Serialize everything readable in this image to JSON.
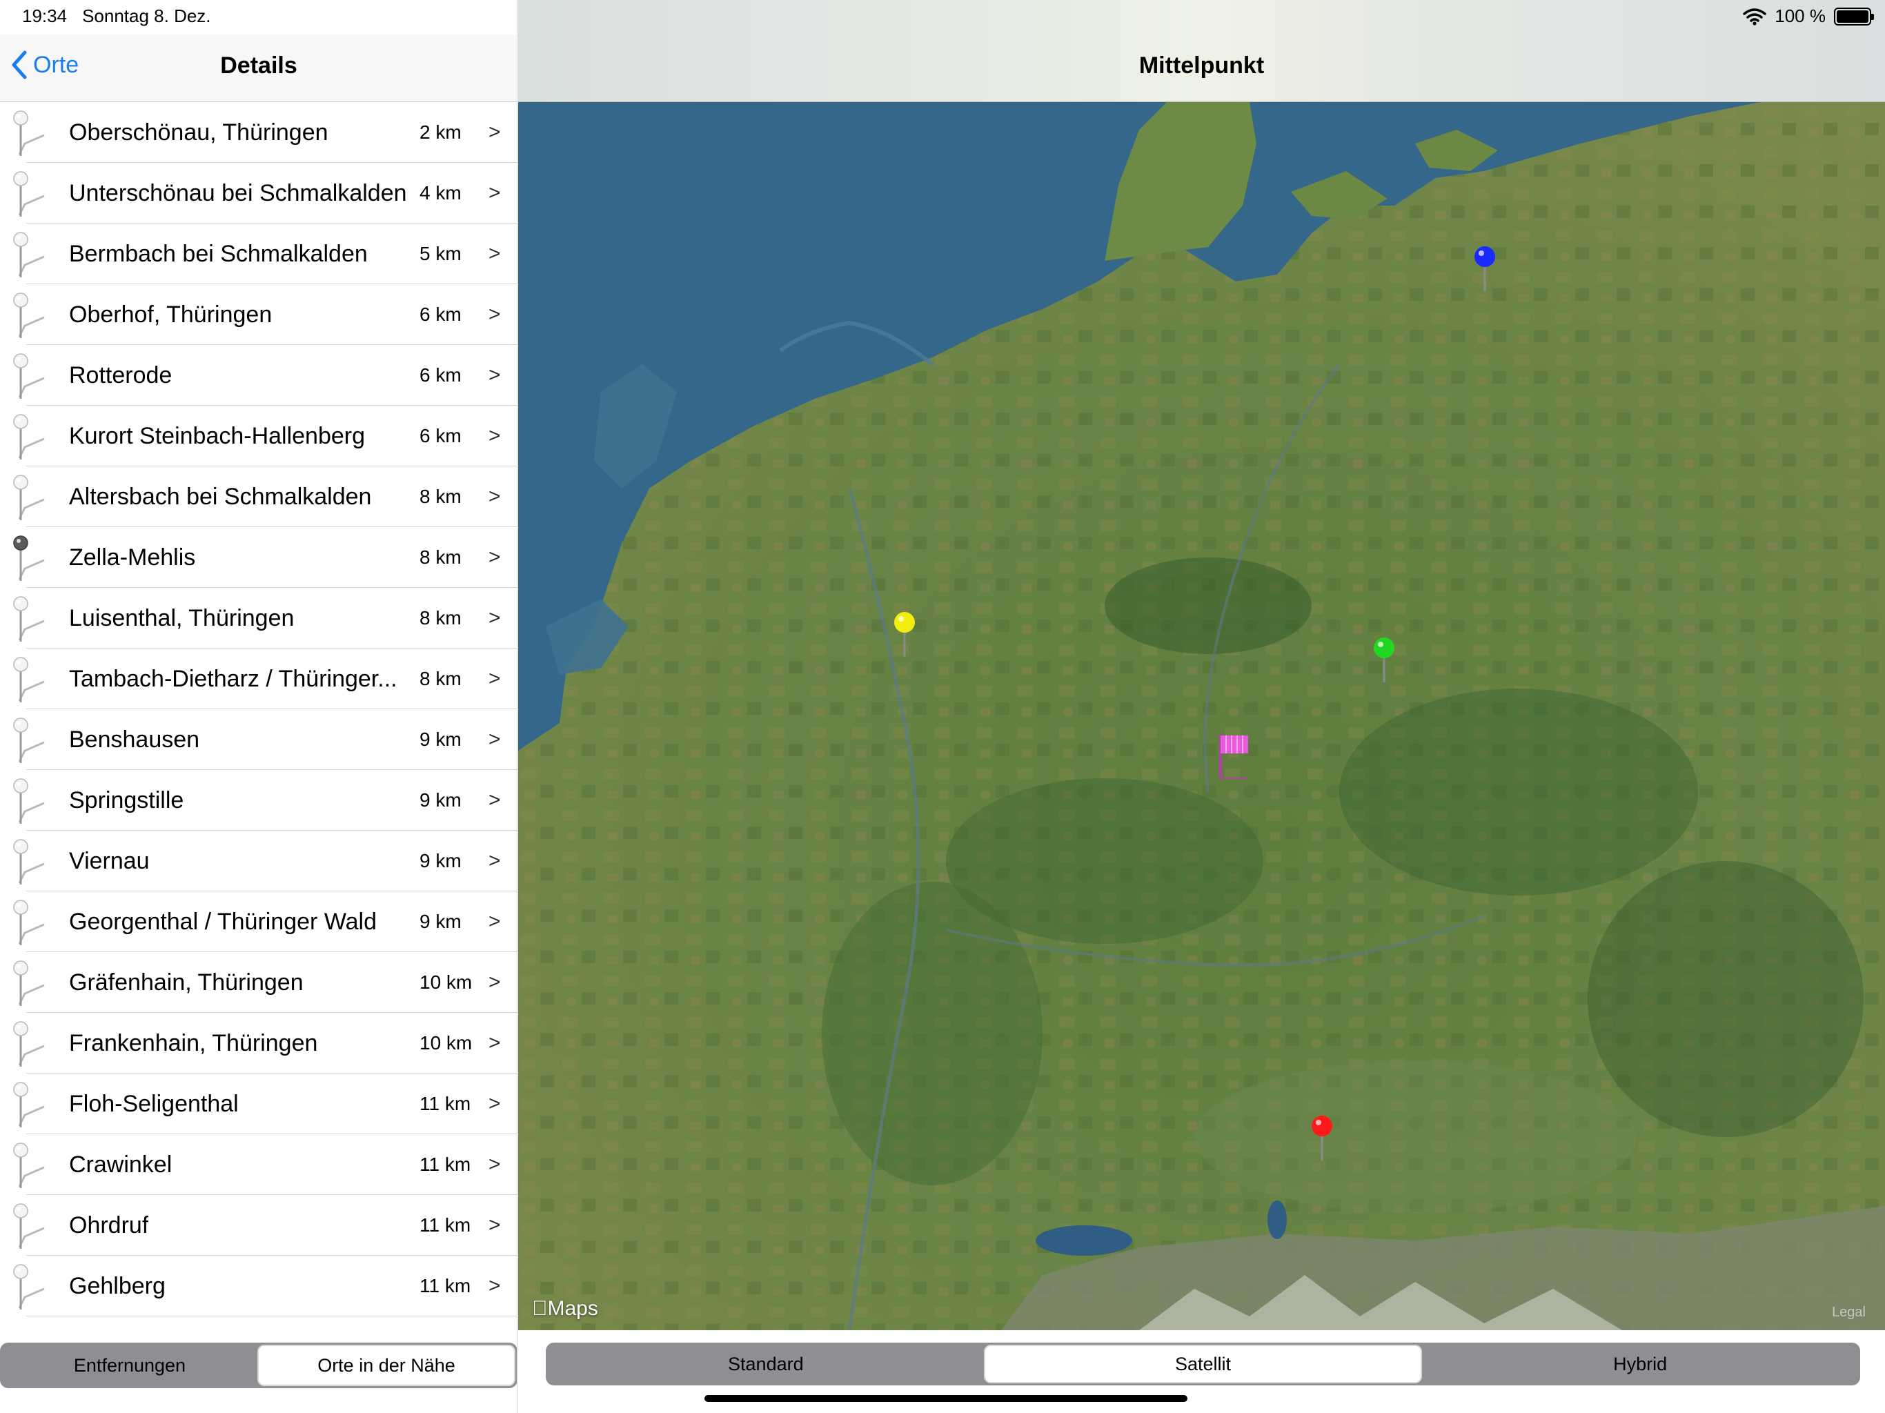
{
  "status": {
    "time": "19:34",
    "date": "Sonntag 8. Dez.",
    "battery_label": "100 %"
  },
  "master": {
    "back_label": "Orte",
    "title": "Details",
    "places": [
      {
        "name": "Oberschönau, Thüringen",
        "distance": "2 km",
        "chevron": ">",
        "selected": false
      },
      {
        "name": "Unterschönau bei Schmalkalden",
        "distance": "4 km",
        "chevron": ">",
        "selected": false
      },
      {
        "name": "Bermbach bei Schmalkalden",
        "distance": "5 km",
        "chevron": ">",
        "selected": false
      },
      {
        "name": "Oberhof, Thüringen",
        "distance": "6 km",
        "chevron": ">",
        "selected": false
      },
      {
        "name": "Rotterode",
        "distance": "6 km",
        "chevron": ">",
        "selected": false
      },
      {
        "name": "Kurort Steinbach-Hallenberg",
        "distance": "6 km",
        "chevron": ">",
        "selected": false
      },
      {
        "name": "Altersbach bei Schmalkalden",
        "distance": "8 km",
        "chevron": ">",
        "selected": false
      },
      {
        "name": "Zella-Mehlis",
        "distance": "8 km",
        "chevron": ">",
        "selected": true
      },
      {
        "name": "Luisenthal, Thüringen",
        "distance": "8 km",
        "chevron": ">",
        "selected": false
      },
      {
        "name": "Tambach-Dietharz / Thüringer...",
        "distance": "8 km",
        "chevron": ">",
        "selected": false
      },
      {
        "name": "Benshausen",
        "distance": "9 km",
        "chevron": ">",
        "selected": false
      },
      {
        "name": "Springstille",
        "distance": "9 km",
        "chevron": ">",
        "selected": false
      },
      {
        "name": "Viernau",
        "distance": "9 km",
        "chevron": ">",
        "selected": false
      },
      {
        "name": "Georgenthal / Thüringer Wald",
        "distance": "9 km",
        "chevron": ">",
        "selected": false
      },
      {
        "name": "Gräfenhain, Thüringen",
        "distance": "10 km",
        "chevron": ">",
        "selected": false
      },
      {
        "name": "Frankenhain, Thüringen",
        "distance": "10 km",
        "chevron": ">",
        "selected": false
      },
      {
        "name": "Floh-Seligenthal",
        "distance": "11 km",
        "chevron": ">",
        "selected": false
      },
      {
        "name": "Crawinkel",
        "distance": "11 km",
        "chevron": ">",
        "selected": false
      },
      {
        "name": "Ohrdruf",
        "distance": "11 km",
        "chevron": ">",
        "selected": false
      },
      {
        "name": "Gehlberg",
        "distance": "11 km",
        "chevron": ">",
        "selected": false
      }
    ],
    "segments": [
      {
        "label": "Entfernungen",
        "active": false
      },
      {
        "label": "Orte in der Nähe",
        "active": true
      }
    ]
  },
  "detail": {
    "title": "Mittelpunkt",
    "maps_logo": "Maps",
    "legal": "Legal",
    "map_type_segments": [
      {
        "label": "Standard",
        "active": false
      },
      {
        "label": "Satellit",
        "active": true
      },
      {
        "label": "Hybrid",
        "active": false
      }
    ],
    "markers": [
      {
        "name": "blue-pin",
        "color": "#1a2bff"
      },
      {
        "name": "yellow-pin",
        "color": "#f2ee10"
      },
      {
        "name": "green-pin",
        "color": "#22d622"
      },
      {
        "name": "red-pin",
        "color": "#ff1a1a"
      },
      {
        "name": "center-flag",
        "color": "#d94ccf"
      }
    ]
  },
  "colors": {
    "accent": "#1a7cf3",
    "segment_bg": "#8e8e93",
    "sea": "#35678a"
  }
}
